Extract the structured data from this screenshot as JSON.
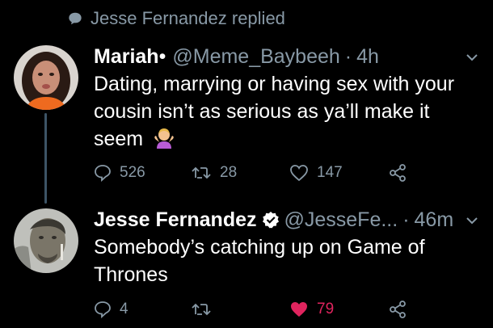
{
  "reply_context": {
    "text": "Jesse Fernandez replied",
    "icon": "speech-bubble-icon"
  },
  "tweets": [
    {
      "name": "Mariah",
      "name_suffix": "•",
      "handle": "@Meme_Baybeeh",
      "separator": "·",
      "time": "4h",
      "text_lines": [
        "Dating, marrying or having sex with your",
        "cousin isn’t as serious as ya’ll make it",
        "seem"
      ],
      "emoji": "person-shrugging-emoji",
      "replies": "526",
      "retweets": "28",
      "likes": "147",
      "liked": false
    },
    {
      "name": "Jesse Fernandez",
      "verified": true,
      "handle": "@JesseFe...",
      "separator": "·",
      "time": "46m",
      "text_lines": [
        "Somebody’s catching up on Game of",
        "Thrones"
      ],
      "replies": "4",
      "retweets": "",
      "likes": "79",
      "liked": true
    }
  ],
  "colors": {
    "background": "#000000",
    "secondary_text": "#8899a6",
    "like_active": "#e0245e",
    "verified": "#ffffff"
  }
}
